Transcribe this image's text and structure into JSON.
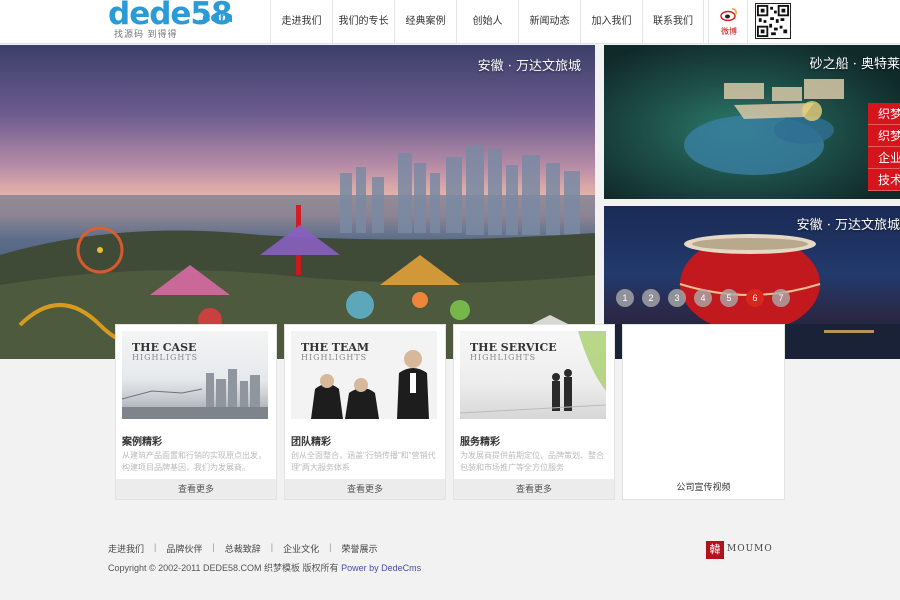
{
  "header": {
    "logo_main": "dede58",
    "logo_com": ".com",
    "logo_tagline": "找源码  到得得",
    "nav": [
      "走进我们",
      "我们的专长",
      "经典案例",
      "创始人",
      "新闻动态",
      "加入我们",
      "联系我们"
    ],
    "weibo_label": "微博",
    "weibo_icon": "weibo-icon",
    "qr_icon": "qr-code-icon"
  },
  "banner": {
    "main_title": "安徽 · 万达文旅城",
    "right_top_title": "砂之船 · 奥特莱",
    "right_bottom_title": "安徽 · 万达文旅城",
    "red_menu": [
      "织梦",
      "织梦",
      "企业",
      "技术"
    ],
    "dots": [
      "1",
      "2",
      "3",
      "4",
      "5",
      "6",
      "7"
    ],
    "active_dot": "6"
  },
  "cards": [
    {
      "thumb_title": "THE CASE",
      "thumb_sub": "HIGHLIGHTS",
      "title": "案例精彩",
      "desc": "从建筑产品面置和行销的实现原点出发，构建项目品牌基因，我们为发展商。",
      "more": "查看更多"
    },
    {
      "thumb_title": "THE TEAM",
      "thumb_sub": "HIGHLIGHTS",
      "title": "团队精彩",
      "desc": "创从全面整合，涵盖\"行销传播\"和\"营销代理\"两大服务体系",
      "more": "查看更多"
    },
    {
      "thumb_title": "THE SERVICE",
      "thumb_sub": "HIGHLIGHTS",
      "title": "服务精彩",
      "desc": "为发展商提供前期定位、品牌策划、整合包装和市场推广等全方位服务",
      "more": "查看更多"
    }
  ],
  "video": {
    "label": "公司宣传视频"
  },
  "footer": {
    "links": [
      "走进我们",
      "品牌伙伴",
      "总裁致辞",
      "企业文化",
      "荣誉展示"
    ],
    "copyright": "Copyright © 2002-2011 DEDE58.COM 织梦模板 版权所有",
    "power": "Power by DedeCms",
    "moumo_seal": "韓",
    "moumo_text": "MOUMO"
  },
  "colors": {
    "brand_blue": "#2a9bd6",
    "accent_red": "#d6141c",
    "background": "#f2f2f2"
  }
}
